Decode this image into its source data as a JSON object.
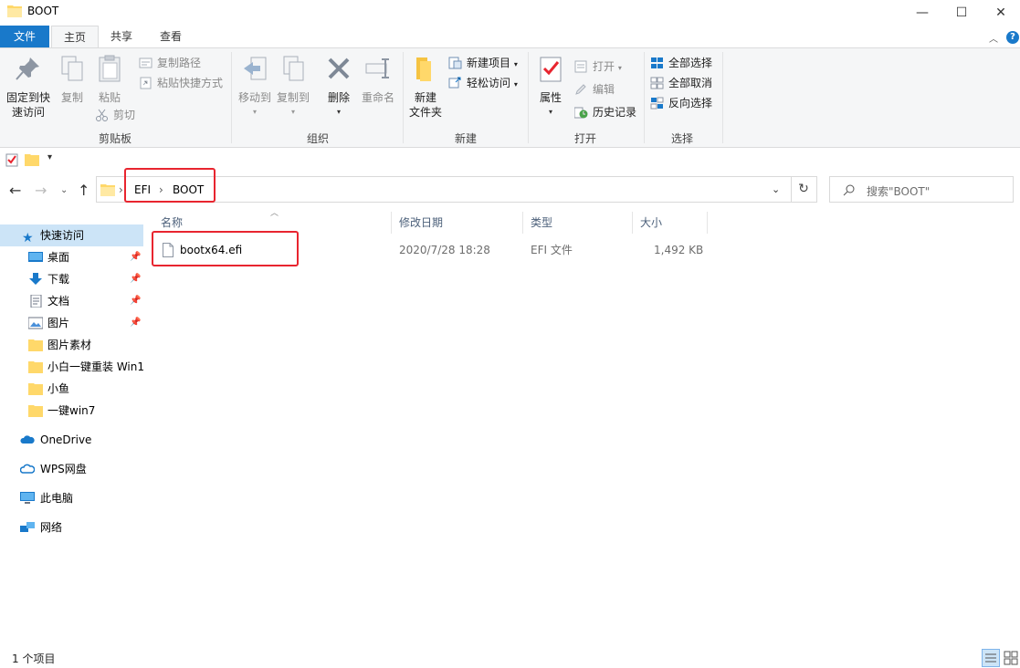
{
  "window": {
    "title": "BOOT"
  },
  "tabs": [
    {
      "label": "文件"
    },
    {
      "label": "主页"
    },
    {
      "label": "共享"
    },
    {
      "label": "查看"
    }
  ],
  "ribbon": {
    "clipboard": {
      "group_label": "剪贴板",
      "pin_quick": "固定到快\n速访问",
      "pin_quick_l1": "固定到快",
      "pin_quick_l2": "速访问",
      "copy": "复制",
      "paste": "粘贴",
      "copy_path": "复制路径",
      "paste_shortcut": "粘贴快捷方式",
      "cut": "剪切"
    },
    "organize": {
      "group_label": "组织",
      "move_to": "移动到",
      "copy_to": "复制到",
      "delete": "删除",
      "rename": "重命名"
    },
    "new": {
      "group_label": "新建",
      "new_folder_l1": "新建",
      "new_folder_l2": "文件夹",
      "new_item": "新建项目",
      "easy_access": "轻松访问"
    },
    "open": {
      "group_label": "打开",
      "properties": "属性",
      "open": "打开",
      "edit": "编辑",
      "history": "历史记录"
    },
    "select": {
      "group_label": "选择",
      "select_all": "全部选择",
      "select_none": "全部取消",
      "invert": "反向选择"
    }
  },
  "address": {
    "crumbs": [
      "EFI",
      "BOOT"
    ],
    "search_placeholder": "搜索\"BOOT\""
  },
  "nav": {
    "quick_access": "快速访问",
    "items": [
      {
        "label": "桌面",
        "pinned": true
      },
      {
        "label": "下载",
        "pinned": true
      },
      {
        "label": "文档",
        "pinned": true
      },
      {
        "label": "图片",
        "pinned": true
      },
      {
        "label": "图片素材",
        "pinned": false
      },
      {
        "label": "小白一键重装 Win1",
        "pinned": false
      },
      {
        "label": "小鱼",
        "pinned": false
      },
      {
        "label": "一键win7",
        "pinned": false
      }
    ],
    "onedrive": "OneDrive",
    "wps": "WPS网盘",
    "this_pc": "此电脑",
    "network": "网络"
  },
  "columns": {
    "name": "名称",
    "modified": "修改日期",
    "type": "类型",
    "size": "大小"
  },
  "files": [
    {
      "name": "bootx64.efi",
      "modified": "2020/7/28 18:28",
      "type": "EFI 文件",
      "size": "1,492 KB"
    }
  ],
  "status": {
    "count": "1 个项目"
  },
  "colors": {
    "accent": "#1979ca",
    "highlight": "#e8252f",
    "selected": "#cce4f7"
  }
}
